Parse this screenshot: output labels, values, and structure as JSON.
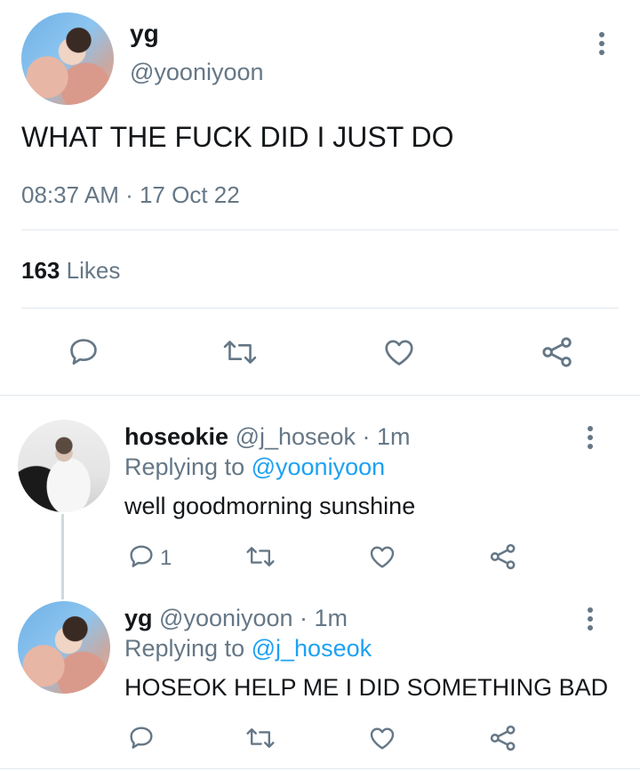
{
  "main_tweet": {
    "display_name": "yg",
    "handle": "@yooniyoon",
    "text": "WHAT THE FUCK DID I JUST DO",
    "timestamp": "08:37 AM · 17 Oct 22",
    "likes_count": "163",
    "likes_label": "Likes"
  },
  "replies": [
    {
      "display_name": "hoseokie",
      "handle_time": "@j_hoseok · 1m",
      "replying_prefix": "Replying to",
      "replying_to": "@yooniyoon",
      "text": "well goodmorning sunshine",
      "reply_count": "1"
    },
    {
      "display_name": "yg",
      "handle_time": "@yooniyoon · 1m",
      "replying_prefix": "Replying to",
      "replying_to": "@j_hoseok",
      "text": "HOSEOK HELP ME I DID SOMETHING BAD",
      "reply_count": ""
    }
  ],
  "colors": {
    "text": "#14171a",
    "secondary": "#657786",
    "accent": "#1da1f2",
    "divider": "#e1e8ed"
  },
  "icons": [
    "reply-icon",
    "retweet-icon",
    "like-icon",
    "share-icon",
    "more-options-icon"
  ]
}
